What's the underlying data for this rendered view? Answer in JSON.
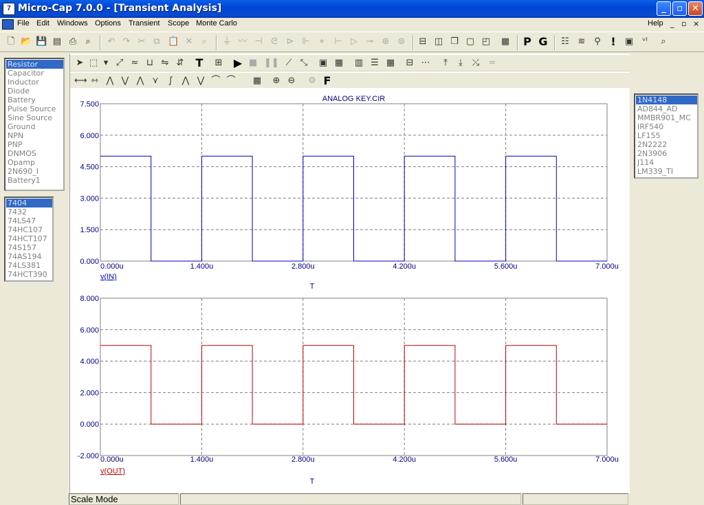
{
  "window": {
    "title": "Micro-Cap 7.0.0 - [Transient Analysis]",
    "app_icon": "micro-cap-icon",
    "controls": {
      "minimize": "_",
      "restore": "▫",
      "close": "✕"
    }
  },
  "menu": {
    "items": [
      "File",
      "Edit",
      "Windows",
      "Options",
      "Transient",
      "Scope",
      "Monte Carlo"
    ],
    "help": "Help",
    "mdi_controls": [
      "_",
      "▫",
      "×"
    ]
  },
  "toolbar_letters": {
    "p": "P",
    "g": "G"
  },
  "subtoolbar_letters": {
    "f": "F"
  },
  "components_list": {
    "selected": "Resistor",
    "items": [
      "Resistor",
      "Capacitor",
      "Inductor",
      "Diode",
      "Battery",
      "Pulse Source",
      "Sine Source",
      "Ground",
      "NPN",
      "PNP",
      "DNMOS",
      "Opamp",
      "2N690_I",
      "Battery1"
    ]
  },
  "digital_list": {
    "selected": "7404",
    "items": [
      "7404",
      "7432",
      "74LS47",
      "74HC107",
      "74HCT107",
      "74S157",
      "74AS194",
      "74LS381",
      "74HCT390"
    ]
  },
  "models_list": {
    "selected": "1N4148",
    "items": [
      "1N4148",
      "AD844_AD",
      "MMBR901_MC",
      "IRF540",
      "LF155",
      "2N2222",
      "2N3906",
      "J114",
      "LM339_TI"
    ]
  },
  "status": {
    "mode": "Scale Mode"
  },
  "colors": {
    "series_in": "#0000b0",
    "series_out": "#c00000",
    "axis_text": "#000080",
    "grid": "#7f7f7f"
  },
  "chart_data": [
    {
      "type": "line",
      "title": "ANALOG KEY.CIR",
      "xlabel": "T",
      "ylabel": "",
      "xlim": [
        0,
        7.0
      ],
      "ylim": [
        0,
        7.5
      ],
      "x_unit": "u",
      "x_ticks": [
        "0.000u",
        "1.400u",
        "2.800u",
        "4.200u",
        "5.600u",
        "7.000u"
      ],
      "y_ticks": [
        "0.000",
        "1.500",
        "3.000",
        "4.500",
        "6.000",
        "7.500"
      ],
      "grid": true,
      "series": [
        {
          "name": "v(IN)",
          "x": [
            0,
            0.7,
            0.7,
            1.4,
            1.4,
            2.1,
            2.1,
            2.8,
            2.8,
            3.5,
            3.5,
            4.2,
            4.2,
            4.9,
            4.9,
            5.6,
            5.6,
            6.3,
            6.3,
            7.0
          ],
          "y": [
            5,
            5,
            0,
            0,
            5,
            5,
            0,
            0,
            5,
            5,
            0,
            0,
            5,
            5,
            0,
            0,
            5,
            5,
            0,
            0
          ]
        }
      ]
    },
    {
      "type": "line",
      "title": "",
      "xlabel": "T",
      "ylabel": "",
      "xlim": [
        0,
        7.0
      ],
      "ylim": [
        -2,
        8
      ],
      "x_unit": "u",
      "x_ticks": [
        "0.000u",
        "1.400u",
        "2.800u",
        "4.200u",
        "5.600u",
        "7.000u"
      ],
      "y_ticks": [
        "-2.000",
        "0.000",
        "2.000",
        "4.000",
        "6.000",
        "8.000"
      ],
      "grid": true,
      "series": [
        {
          "name": "v(OUT)",
          "x": [
            0,
            0.7,
            0.7,
            1.4,
            1.4,
            2.1,
            2.1,
            2.8,
            2.8,
            3.5,
            3.5,
            4.2,
            4.2,
            4.9,
            4.9,
            5.6,
            5.6,
            6.3,
            6.3,
            7.0
          ],
          "y": [
            5,
            5,
            0,
            0,
            5,
            5,
            0,
            0,
            5,
            5,
            0,
            0,
            5,
            5,
            0,
            0,
            5,
            5,
            0,
            0
          ]
        }
      ]
    }
  ]
}
